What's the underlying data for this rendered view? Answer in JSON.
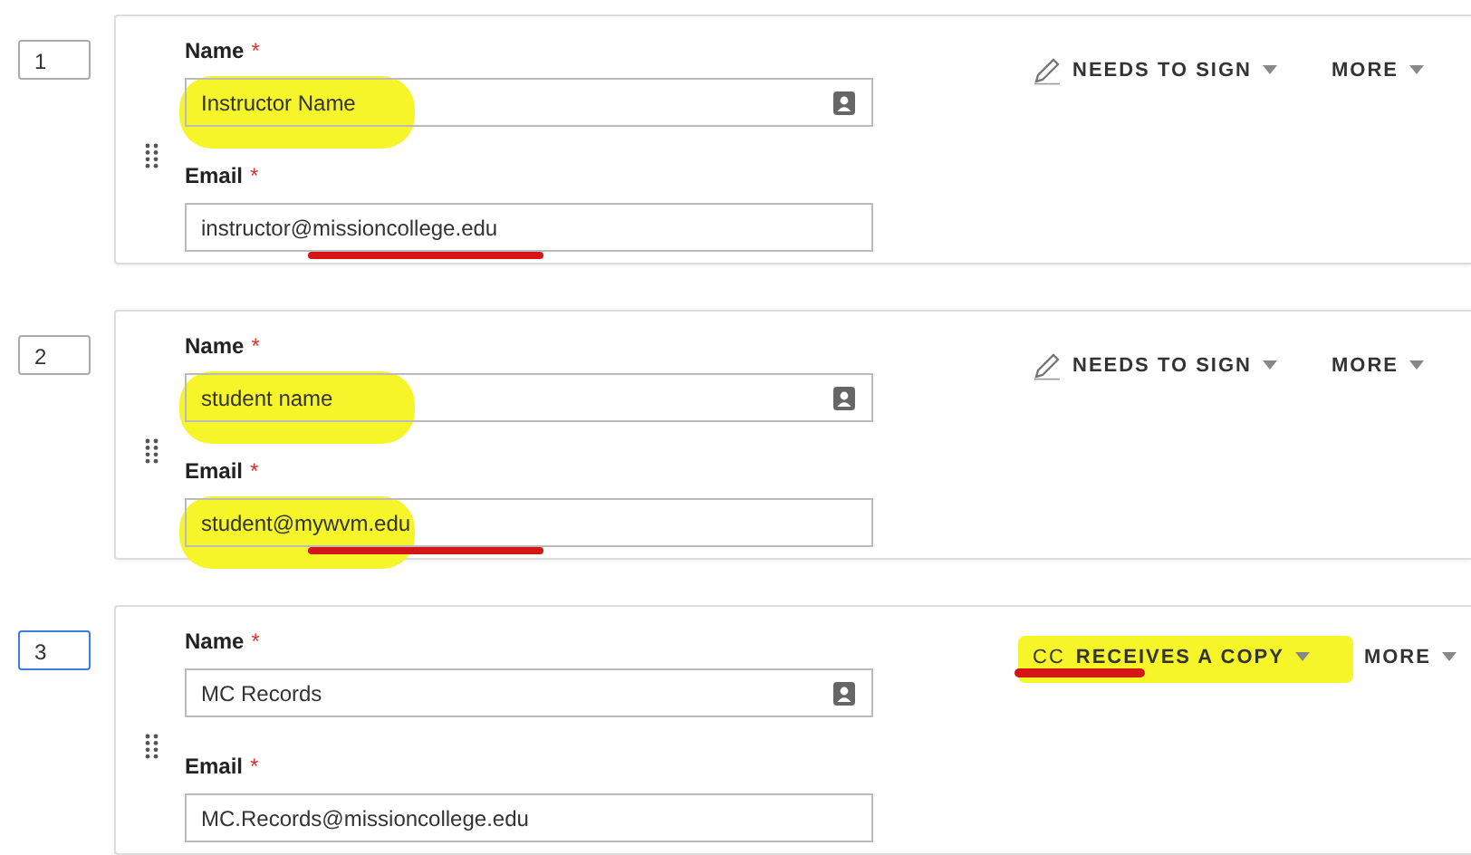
{
  "recipients": [
    {
      "order": "1",
      "focused": false,
      "name_label": "Name",
      "email_label": "Email",
      "required": "*",
      "name": {
        "value": "Instructor Name",
        "highlighted": true,
        "underlined": false
      },
      "email": {
        "value": "instructor@missioncollege.edu",
        "highlighted": false,
        "underlined": true
      },
      "role": {
        "kind": "sign",
        "label": "NEEDS TO SIGN",
        "highlighted": false,
        "underlined": false
      },
      "more": "MORE"
    },
    {
      "order": "2",
      "focused": false,
      "name_label": "Name",
      "email_label": "Email",
      "required": "*",
      "name": {
        "value": "student name",
        "highlighted": true,
        "underlined": false
      },
      "email": {
        "value": "student@mywvm.edu",
        "highlighted": true,
        "underlined": true
      },
      "role": {
        "kind": "sign",
        "label": "NEEDS TO SIGN",
        "highlighted": false,
        "underlined": false
      },
      "more": "MORE"
    },
    {
      "order": "3",
      "focused": true,
      "name_label": "Name",
      "email_label": "Email",
      "required": "*",
      "name": {
        "value": "MC Records",
        "highlighted": false,
        "underlined": false
      },
      "email": {
        "value": "MC.Records@missioncollege.edu",
        "highlighted": false,
        "underlined": false
      },
      "role": {
        "kind": "cc",
        "badge": "CC",
        "label": "RECEIVES A COPY",
        "highlighted": true,
        "underlined": true
      },
      "more": "MORE"
    }
  ]
}
